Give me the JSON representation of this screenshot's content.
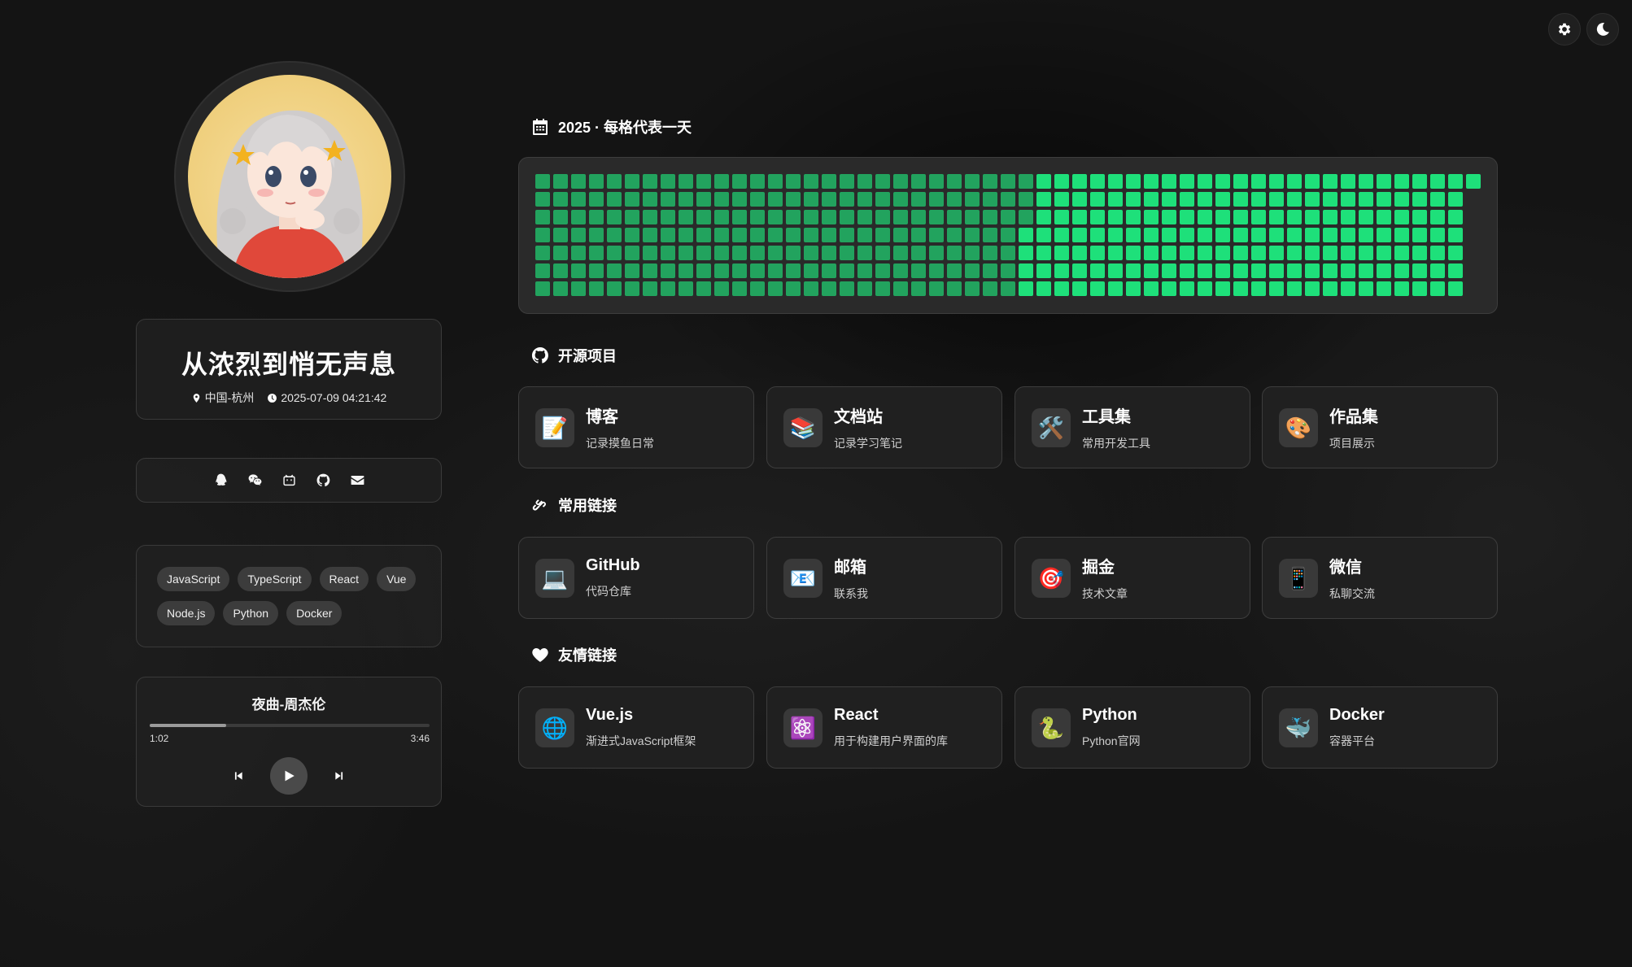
{
  "top_buttons": {
    "settings_icon": "gear-icon",
    "theme_icon": "moon-icon"
  },
  "profile": {
    "name": "从浓烈到悄无声息",
    "location": "中国-杭州",
    "datetime": "2025-07-09 04:21:42"
  },
  "social": [
    "qq-icon",
    "wechat-icon",
    "bilibili-icon",
    "github-icon",
    "mail-icon"
  ],
  "tags": [
    "JavaScript",
    "TypeScript",
    "React",
    "Vue",
    "Node.js",
    "Python",
    "Docker"
  ],
  "player": {
    "title": "夜曲-周杰伦",
    "current": "1:02",
    "total": "3:46",
    "progress": 0.274
  },
  "heatmap": {
    "title": "2025 · 每格代表一天",
    "colors": {
      "past": "#22a35e",
      "future": "#1ee07a"
    },
    "weeks": 53,
    "today_week": 27,
    "today_day": 3
  },
  "sections": {
    "projects": {
      "title": "开源项目",
      "items": [
        {
          "title": "博客",
          "subtitle": "记录摸鱼日常",
          "emoji": "📝"
        },
        {
          "title": "文档站",
          "subtitle": "记录学习笔记",
          "emoji": "📚"
        },
        {
          "title": "工具集",
          "subtitle": "常用开发工具",
          "emoji": "🛠️"
        },
        {
          "title": "作品集",
          "subtitle": "项目展示",
          "emoji": "🎨"
        }
      ]
    },
    "links": {
      "title": "常用链接",
      "items": [
        {
          "title": "GitHub",
          "subtitle": "代码仓库",
          "emoji": "💻"
        },
        {
          "title": "邮箱",
          "subtitle": "联系我",
          "emoji": "📧"
        },
        {
          "title": "掘金",
          "subtitle": "技术文章",
          "emoji": "🎯"
        },
        {
          "title": "微信",
          "subtitle": "私聊交流",
          "emoji": "📱"
        }
      ]
    },
    "friends": {
      "title": "友情链接",
      "items": [
        {
          "title": "Vue.js",
          "subtitle": "渐进式JavaScript框架",
          "emoji": "🌐"
        },
        {
          "title": "React",
          "subtitle": "用于构建用户界面的库",
          "emoji": "⚛️"
        },
        {
          "title": "Python",
          "subtitle": "Python官网",
          "emoji": "🐍"
        },
        {
          "title": "Docker",
          "subtitle": "容器平台",
          "emoji": "🐳"
        }
      ]
    }
  }
}
